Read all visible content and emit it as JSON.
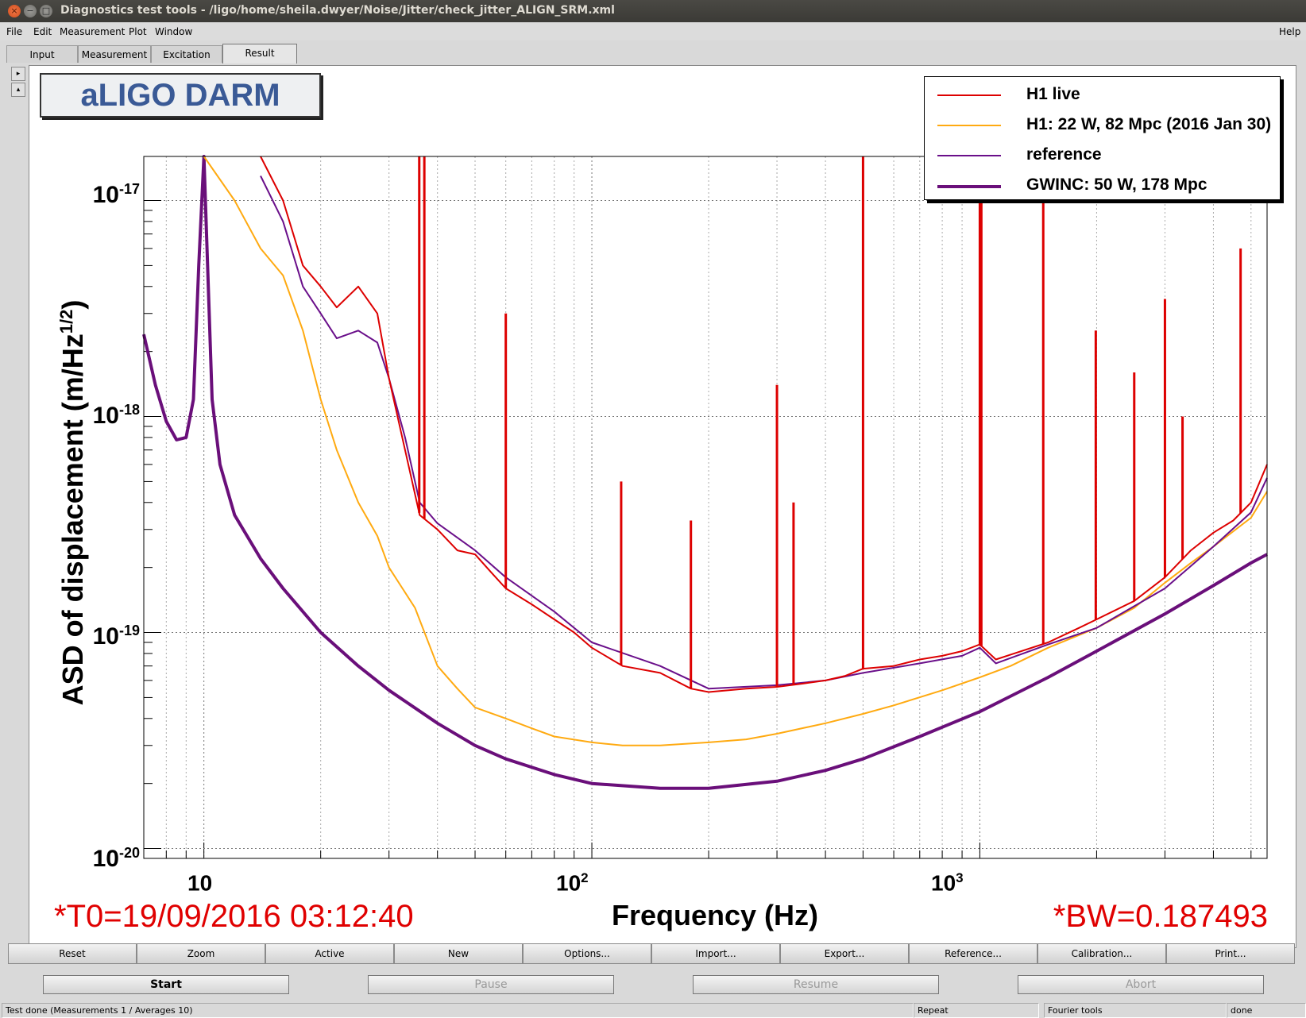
{
  "window": {
    "title": "Diagnostics test tools - /ligo/home/sheila.dwyer/Noise/Jitter/check_jitter_ALIGN_SRM.xml",
    "close": "×",
    "minimize": "−",
    "maximize": "□"
  },
  "menu": {
    "file": "File",
    "edit": "Edit",
    "measurement": "Measurement",
    "plot": "Plot",
    "window": "Window",
    "help": "Help"
  },
  "tabs": [
    "Input",
    "Measurement",
    "Excitation",
    "Result"
  ],
  "side_arrows": [
    "▸",
    "▴"
  ],
  "plot": {
    "title": "aLIGO DARM",
    "ylabel": "ASD of displacement (m/Hz",
    "ylabel_sup": "1/2",
    "ylabel_end": ")",
    "xlabel": "Frequency (Hz)",
    "t0": "*T0=19/09/2016 03:12:40",
    "bw": "*BW=0.187493",
    "y_ticks": [
      {
        "base": "10",
        "exp": "-17"
      },
      {
        "base": "10",
        "exp": "-18"
      },
      {
        "base": "10",
        "exp": "-19"
      },
      {
        "base": "10",
        "exp": "-20"
      }
    ],
    "x_ticks": [
      {
        "base": "10",
        "exp": ""
      },
      {
        "base": "10",
        "exp": "2"
      },
      {
        "base": "10",
        "exp": "3"
      }
    ]
  },
  "legend": [
    {
      "label": "H1 live",
      "color": "#dd0000"
    },
    {
      "label": "H1: 22 W, 82 Mpc (2016 Jan 30)",
      "color": "#ffaa11"
    },
    {
      "label": "reference",
      "color": "#6a0f8a"
    },
    {
      "label": "GWINC: 50 W, 178 Mpc",
      "color": "#6a0f7a"
    }
  ],
  "chart_data": {
    "type": "line",
    "title": "aLIGO DARM",
    "xlabel": "Frequency (Hz)",
    "ylabel": "ASD of displacement (m/Hz^1/2)",
    "x_scale": "log",
    "y_scale": "log",
    "xlim": [
      7,
      5500
    ],
    "ylim": [
      9e-21,
      1.6e-17
    ],
    "grid": true,
    "legend_position": "top-right",
    "series": [
      {
        "name": "H1 live",
        "color": "#dd0000",
        "x": [
          14,
          16,
          18,
          20,
          22,
          25,
          28,
          30,
          33,
          36,
          40,
          45,
          50,
          55,
          60,
          70,
          80,
          90,
          100,
          120,
          150,
          180,
          200,
          250,
          300,
          350,
          400,
          450,
          500,
          600,
          700,
          800,
          900,
          1000,
          1100,
          1200,
          1500,
          1800,
          2000,
          2500,
          3000,
          3500,
          4000,
          4500,
          5000,
          5500
        ],
        "y": [
          1.6e-17,
          1e-17,
          5e-18,
          4e-18,
          3.2e-18,
          4e-18,
          3e-18,
          1.5e-18,
          7e-19,
          3.5e-19,
          3e-19,
          2.4e-19,
          2.3e-19,
          1.9e-19,
          1.6e-19,
          1.35e-19,
          1.15e-19,
          1e-19,
          8.5e-20,
          7e-20,
          6.5e-20,
          5.5e-20,
          5.3e-20,
          5.5e-20,
          5.6e-20,
          5.8e-20,
          6e-20,
          6.3e-20,
          6.8e-20,
          7e-20,
          7.5e-20,
          7.8e-20,
          8.2e-20,
          8.8e-20,
          7.5e-20,
          7.9e-20,
          9e-20,
          1.05e-19,
          1.15e-19,
          1.4e-19,
          1.8e-19,
          2.4e-19,
          2.9e-19,
          3.3e-19,
          4e-19,
          6e-19
        ]
      },
      {
        "name": "H1: 22 W, 82 Mpc (2016 Jan 30)",
        "color": "#ffaa11",
        "x": [
          10,
          12,
          14,
          16,
          18,
          20,
          22,
          25,
          28,
          30,
          35,
          40,
          45,
          50,
          60,
          70,
          80,
          100,
          120,
          150,
          200,
          250,
          300,
          400,
          500,
          600,
          800,
          1000,
          1200,
          1500,
          2000,
          2500,
          3000,
          3500,
          4000,
          5000,
          5500
        ],
        "y": [
          1.6e-17,
          1e-17,
          6e-18,
          4.5e-18,
          2.5e-18,
          1.2e-18,
          7e-19,
          4e-19,
          2.8e-19,
          2e-19,
          1.3e-19,
          7e-20,
          5.5e-20,
          4.5e-20,
          4e-20,
          3.6e-20,
          3.3e-20,
          3.1e-20,
          3e-20,
          3e-20,
          3.1e-20,
          3.2e-20,
          3.4e-20,
          3.8e-20,
          4.2e-20,
          4.6e-20,
          5.4e-20,
          6.2e-20,
          7e-20,
          8.5e-20,
          1.05e-19,
          1.3e-19,
          1.7e-19,
          2.1e-19,
          2.5e-19,
          3.4e-19,
          4.5e-19
        ]
      },
      {
        "name": "reference",
        "color": "#6a0f8a",
        "x": [
          14,
          16,
          18,
          20,
          22,
          25,
          28,
          30,
          33,
          36,
          40,
          50,
          60,
          80,
          100,
          150,
          200,
          300,
          400,
          500,
          700,
          900,
          1000,
          1100,
          1500,
          2000,
          3000,
          4000,
          5000,
          5500
        ],
        "y": [
          1.3e-17,
          8e-18,
          4e-18,
          3e-18,
          2.3e-18,
          2.5e-18,
          2.2e-18,
          1.5e-18,
          8e-19,
          4e-19,
          3.2e-19,
          2.4e-19,
          1.8e-19,
          1.25e-19,
          9e-20,
          7e-20,
          5.5e-20,
          5.7e-20,
          6e-20,
          6.5e-20,
          7.2e-20,
          7.8e-20,
          8.5e-20,
          7.2e-20,
          8.8e-20,
          1.05e-19,
          1.6e-19,
          2.5e-19,
          3.6e-19,
          5.2e-19
        ]
      },
      {
        "name": "GWINC: 50 W, 178 Mpc",
        "color": "#6a0f7a",
        "x": [
          7,
          7.5,
          8,
          8.5,
          9,
          9.4,
          9.7,
          10,
          10.5,
          11,
          12,
          14,
          16,
          20,
          25,
          30,
          40,
          50,
          60,
          80,
          100,
          150,
          200,
          300,
          400,
          500,
          700,
          1000,
          1500,
          2000,
          3000,
          4000,
          5000,
          5500
        ],
        "y": [
          2.4e-18,
          1.4e-18,
          9.5e-19,
          7.8e-19,
          8e-19,
          1.2e-18,
          5e-18,
          1.6e-17,
          1.2e-18,
          6e-19,
          3.5e-19,
          2.2e-19,
          1.6e-19,
          1e-19,
          7e-20,
          5.4e-20,
          3.8e-20,
          3e-20,
          2.6e-20,
          2.2e-20,
          2e-20,
          1.9e-20,
          1.9e-20,
          2.05e-20,
          2.3e-20,
          2.6e-20,
          3.3e-20,
          4.3e-20,
          6.2e-20,
          8.2e-20,
          1.22e-19,
          1.65e-19,
          2.1e-19,
          2.3e-19
        ]
      }
    ],
    "spikes": [
      {
        "x": 35.9,
        "y": 1.6e-17
      },
      {
        "x": 37,
        "y": 1.6e-17
      },
      {
        "x": 60,
        "y": 3e-18
      },
      {
        "x": 119,
        "y": 5e-19
      },
      {
        "x": 180,
        "y": 3.3e-19
      },
      {
        "x": 300,
        "y": 1.4e-18
      },
      {
        "x": 331,
        "y": 4e-19
      },
      {
        "x": 500,
        "y": 1.6e-17
      },
      {
        "x": 1000,
        "y": 1.6e-17
      },
      {
        "x": 1009,
        "y": 1.6e-17
      },
      {
        "x": 1457,
        "y": 1.6e-17
      },
      {
        "x": 1990,
        "y": 2.5e-18
      },
      {
        "x": 2500,
        "y": 1.6e-18
      },
      {
        "x": 3000,
        "y": 3.5e-18
      },
      {
        "x": 3330,
        "y": 1e-18
      },
      {
        "x": 4700,
        "y": 6e-18
      }
    ]
  },
  "buttons_row1": [
    "Reset",
    "Zoom",
    "Active",
    "New",
    "Options...",
    "Import...",
    "Export...",
    "Reference...",
    "Calibration...",
    "Print..."
  ],
  "buttons_row2": [
    "Start",
    "Pause",
    "Resume",
    "Abort"
  ],
  "status": {
    "main": "Test done (Measurements 1 / Averages 10)",
    "repeat": "Repeat",
    "tool": "Fourier tools",
    "state": "done"
  }
}
